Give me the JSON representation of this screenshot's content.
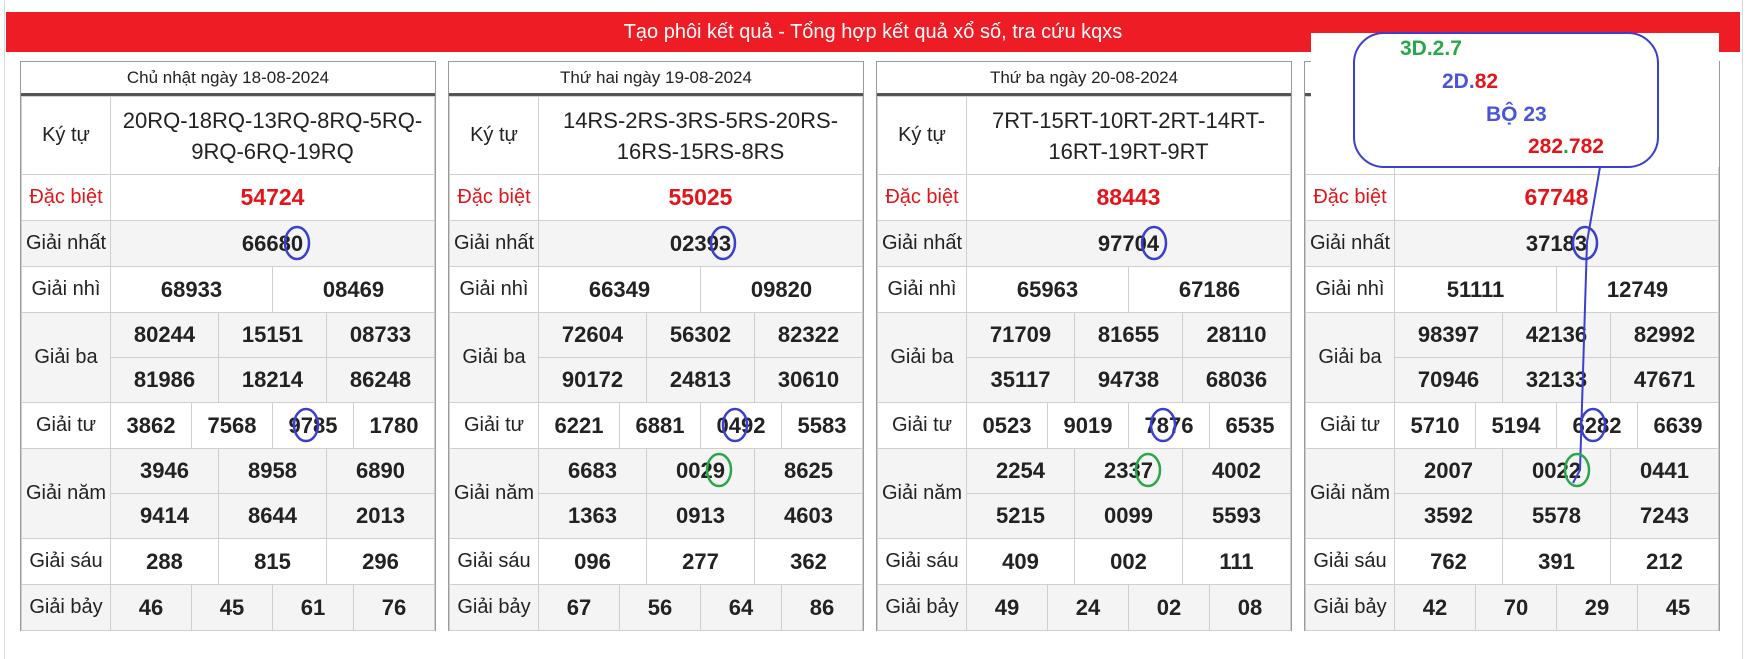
{
  "header": {
    "title": "Tạo phôi kết quả - Tổng hợp kết quả xổ số, tra cứu kqxs"
  },
  "labels": {
    "ky_tu": "Ký tự",
    "dac_biet": "Đặc biệt",
    "giai_nhat": "Giải nhất",
    "giai_nhi": "Giải nhì",
    "giai_ba": "Giải ba",
    "giai_tu": "Giải tư",
    "giai_nam": "Giải năm",
    "giai_sau": "Giải sáu",
    "giai_bay": "Giải bảy"
  },
  "boards": [
    {
      "date": "Chủ nhật ngày 18-08-2024",
      "ky_tu_line1": "20RQ-18RQ-13RQ-8RQ-5RQ-",
      "ky_tu_line2": "9RQ-6RQ-19RQ",
      "dac_biet": "54724",
      "giai_nhat": "66680",
      "giai_nhi": [
        "68933",
        "08469"
      ],
      "giai_ba": [
        "80244",
        "15151",
        "08733",
        "81986",
        "18214",
        "86248"
      ],
      "giai_tu": [
        "3862",
        "7568",
        "9785",
        "1780"
      ],
      "giai_nam": [
        "3946",
        "8958",
        "6890",
        "9414",
        "8644",
        "2013"
      ],
      "giai_sau": [
        "288",
        "815",
        "296"
      ],
      "giai_bay": [
        "46",
        "45",
        "61",
        "76"
      ]
    },
    {
      "date": "Thứ hai ngày 19-08-2024",
      "ky_tu_line1": "14RS-2RS-3RS-5RS-20RS-",
      "ky_tu_line2": "16RS-15RS-8RS",
      "dac_biet": "55025",
      "giai_nhat": "02393",
      "giai_nhi": [
        "66349",
        "09820"
      ],
      "giai_ba": [
        "72604",
        "56302",
        "82322",
        "90172",
        "24813",
        "30610"
      ],
      "giai_tu": [
        "6221",
        "6881",
        "0492",
        "5583"
      ],
      "giai_nam": [
        "6683",
        "0029",
        "8625",
        "1363",
        "0913",
        "4603"
      ],
      "giai_sau": [
        "096",
        "277",
        "362"
      ],
      "giai_bay": [
        "67",
        "56",
        "64",
        "86"
      ]
    },
    {
      "date": "Thứ ba ngày 20-08-2024",
      "ky_tu_line1": "7RT-15RT-10RT-2RT-14RT-",
      "ky_tu_line2": "16RT-19RT-9RT",
      "dac_biet": "88443",
      "giai_nhat": "97704",
      "giai_nhi": [
        "65963",
        "67186"
      ],
      "giai_ba": [
        "71709",
        "81655",
        "28110",
        "35117",
        "94738",
        "68036"
      ],
      "giai_tu": [
        "0523",
        "9019",
        "7876",
        "6535"
      ],
      "giai_nam": [
        "2254",
        "2337",
        "4002",
        "5215",
        "0099",
        "5593"
      ],
      "giai_sau": [
        "409",
        "002",
        "111"
      ],
      "giai_bay": [
        "49",
        "24",
        "02",
        "08"
      ]
    },
    {
      "date": "",
      "ky_tu_line1": "",
      "ky_tu_line2": "",
      "dac_biet": "67748",
      "giai_nhat": "37183",
      "giai_nhi": [
        "51111",
        "12749"
      ],
      "giai_ba": [
        "98397",
        "42136",
        "82992",
        "70946",
        "32133",
        "47671"
      ],
      "giai_tu": [
        "5710",
        "5194",
        "6282",
        "6639"
      ],
      "giai_nam": [
        "2007",
        "0022",
        "0441",
        "3592",
        "5578",
        "7243"
      ],
      "giai_sau": [
        "762",
        "391",
        "212"
      ],
      "giai_bay": [
        "42",
        "70",
        "29",
        "45"
      ]
    }
  ],
  "annotation": {
    "line1": {
      "a": "3D.2.7",
      "color": "#2aa748"
    },
    "line2": {
      "a": "2D.",
      "b": "82",
      "color_a": "#4a55d6",
      "color_b": "#e3151a"
    },
    "line3": {
      "a": "BỘ 23",
      "color": "#4a55d6"
    },
    "line4": {
      "a": "282",
      "b": ".",
      "c": "782",
      "color_a": "#e3151a",
      "color_b": "#2aa748",
      "color_c": "#e3151a"
    },
    "circle_blue": "#3a3fcf",
    "circle_green": "#2aa748"
  },
  "colors": {
    "header": "#ee1c25",
    "special": "#e3151a"
  }
}
